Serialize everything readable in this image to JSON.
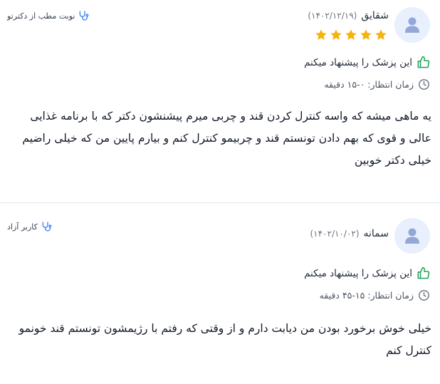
{
  "reviews": [
    {
      "author": "شقایق",
      "date": "(۱۴۰۲/۱۲/۱۹)",
      "rating": 5,
      "tag": "نوبت مطب از دکترتو",
      "recommend": "این پزشک را پیشنهاد میکنم",
      "wait_time": "زمان انتظار: ۰-۱۵ دقیقه",
      "comment": "یه ماهی میشه که واسه کنترل کردن قند و چربی میرم پیشنشون دکتر که با برنامه غذایی عالی و قوی که بهم دادن تونستم قند و چربیمو کنترل کنم و بیارم پایین من که خیلی راضیم خیلی دکتر خوبین"
    },
    {
      "author": "سمانه",
      "date": "(۱۴۰۲/۱۰/۰۲)",
      "tag": "کاربر آزاد",
      "recommend": "این پزشک را پیشنهاد میکنم",
      "wait_time": "زمان انتظار: ۱۵-۴۵ دقیقه",
      "comment": "خیلی خوش برخورد بودن من دیابت دارم و از وقتی که رفتم با رژیمشون تونستم قند خونمو کنترل کنم"
    }
  ],
  "colors": {
    "star": "#f5b30b",
    "thumb": "#22a35a",
    "stethoscope": "#3b82f6",
    "avatar_bg": "#e8effd",
    "avatar_icon": "#93a8d8"
  }
}
